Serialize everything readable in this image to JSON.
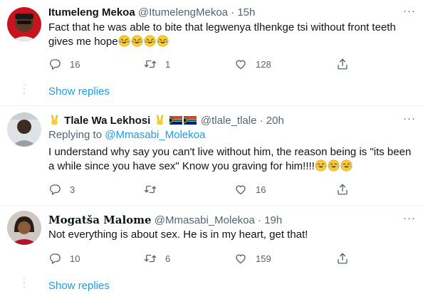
{
  "tweets": [
    {
      "name": "Itumeleng Mekoa",
      "handle": "@ItumelengMekoa",
      "time": "15h",
      "text": "Fact that he was able to bite that legwenya tlhenkge tsi without front teeth gives me hope",
      "emojis": [
        "rolling-laughing",
        "rolling-laughing",
        "rolling-laughing",
        "rolling-laughing"
      ],
      "replies": "16",
      "retweets": "1",
      "likes": "128",
      "show_replies": "Show replies"
    },
    {
      "name_prefix_emoji": "victory-hand",
      "name": "Tlale Wa Lekhosi",
      "name_suffix_emoji": "victory-hand",
      "flags": [
        "south-africa-flag",
        "south-africa-flag"
      ],
      "handle": "@tlale_tlale",
      "time": "20h",
      "replying_to_label": "Replying to",
      "replying_to": "@Mmasabi_Molekoa",
      "text": "I understand why say you can't live without him, the reason being is \"its been a while since you have sex\" Know you graving for him!!!!",
      "emojis": [
        "tears-of-joy",
        "tears-of-joy",
        "tears-of-joy"
      ],
      "replies": "3",
      "retweets": "",
      "likes": "16"
    },
    {
      "name": "Mogatša Malome",
      "handle": "@Mmasabi_Molekoa",
      "time": "19h",
      "text": "Not everything is about sex. He is in my heart, get that!",
      "replies": "10",
      "retweets": "6",
      "likes": "159",
      "show_replies": "Show replies"
    }
  ],
  "separator": "·",
  "more_glyph": "···",
  "colors": {
    "accent": "#1d9bf0",
    "secondary": "#536471",
    "text": "#0f1419",
    "divider": "#eff3f4"
  }
}
